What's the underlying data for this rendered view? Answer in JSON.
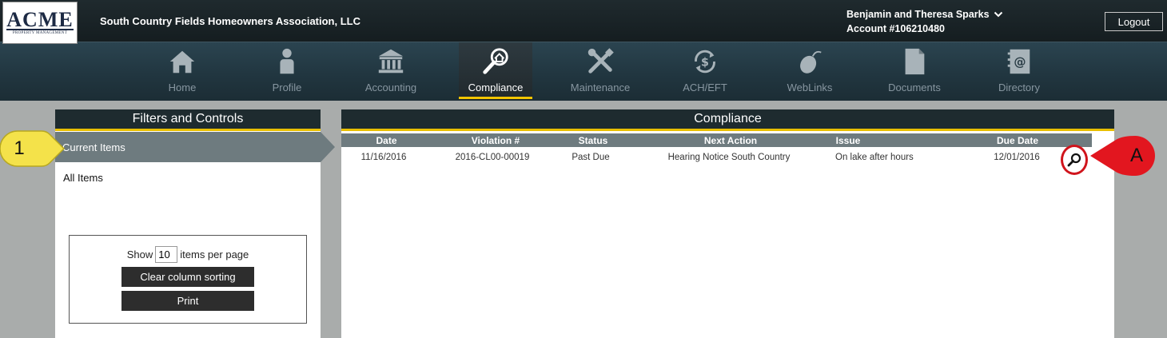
{
  "header": {
    "logo_text": "ACME",
    "logo_subtext": "PROPERTY MANAGEMENT",
    "org_name": "South Country Fields Homeowners Association, LLC",
    "user_name": "Benjamin and Theresa Sparks",
    "account": "Account #106210480",
    "logout_label": "Logout"
  },
  "nav": {
    "items": [
      {
        "label": "Home",
        "icon": "home-icon"
      },
      {
        "label": "Profile",
        "icon": "profile-icon"
      },
      {
        "label": "Accounting",
        "icon": "bank-icon"
      },
      {
        "label": "Compliance",
        "icon": "compliance-icon",
        "active": true
      },
      {
        "label": "Maintenance",
        "icon": "tools-icon"
      },
      {
        "label": "ACH/EFT",
        "icon": "dollar-refresh-icon"
      },
      {
        "label": "WebLinks",
        "icon": "mouse-icon"
      },
      {
        "label": "Documents",
        "icon": "document-icon"
      },
      {
        "label": "Directory",
        "icon": "address-book-icon"
      }
    ]
  },
  "filters": {
    "title": "Filters and Controls",
    "current_items": "Current Items",
    "all_items": "All Items",
    "show_label": "Show",
    "per_page_value": "10",
    "per_page_suffix": "items per page",
    "clear_sorting_label": "Clear column sorting",
    "print_label": "Print"
  },
  "compliance": {
    "title": "Compliance",
    "columns": [
      "Date",
      "Violation #",
      "Status",
      "Next Action",
      "Issue",
      "Due Date"
    ],
    "rows": [
      {
        "date": "11/16/2016",
        "violation": "2016-CL00-00019",
        "status": "Past Due",
        "next_action": "Hearing Notice South Country",
        "issue": "On lake after hours",
        "due_date": "12/01/2016"
      }
    ]
  },
  "callouts": {
    "one": "1",
    "a": "A"
  },
  "colors": {
    "accent_yellow": "#e9bf00",
    "highlight_red": "#d0141c",
    "callout_yellow": "#f4e24a"
  }
}
